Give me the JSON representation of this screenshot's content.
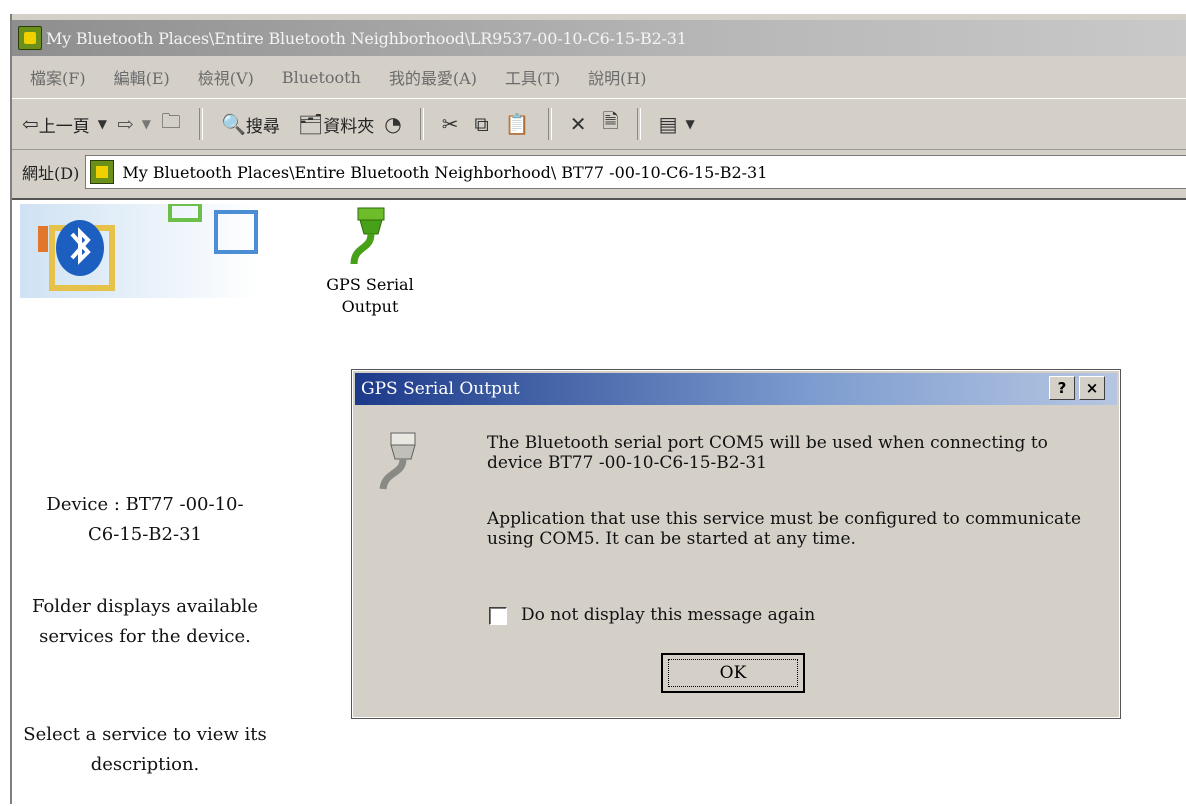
{
  "window": {
    "title": "My Bluetooth Places\\Entire Bluetooth Neighborhood\\LR9537-00-10-C6-15-B2-31"
  },
  "menu": [
    "檔案(F)",
    "編輯(E)",
    "檢視(V)",
    "Bluetooth",
    "我的最愛(A)",
    "工具(T)",
    "說明(H)"
  ],
  "toolbar": {
    "back_label": "上一頁",
    "search_label": "搜尋",
    "folders_label": "資料夾"
  },
  "address": {
    "label": "網址(D)",
    "value": "My Bluetooth Places\\Entire Bluetooth Neighborhood\\  BT77 -00-10-C6-15-B2-31"
  },
  "left_pane": {
    "device_line1": "Device : BT77 -00-10-",
    "device_line2": "C6-15-B2-31",
    "folder_line1": "Folder displays available",
    "folder_line2": "services for the device.",
    "select_line1": "Select a service to view its",
    "select_line2": "description."
  },
  "service_item": {
    "label_line1": "GPS Serial",
    "label_line2": "Output"
  },
  "dialog": {
    "title": "GPS Serial Output",
    "help_label": "?",
    "close_label": "×",
    "message1_line1": "The Bluetooth serial port COM5 will be used when connecting to",
    "message1_line2": "device   BT77 -00-10-C6-15-B2-31",
    "message2_line1": "Application that use this service must be configured to communicate",
    "message2_line2": "using COM5.  It can be started at any time.",
    "checkbox_label": "Do not display this message again",
    "ok_label": "OK"
  }
}
